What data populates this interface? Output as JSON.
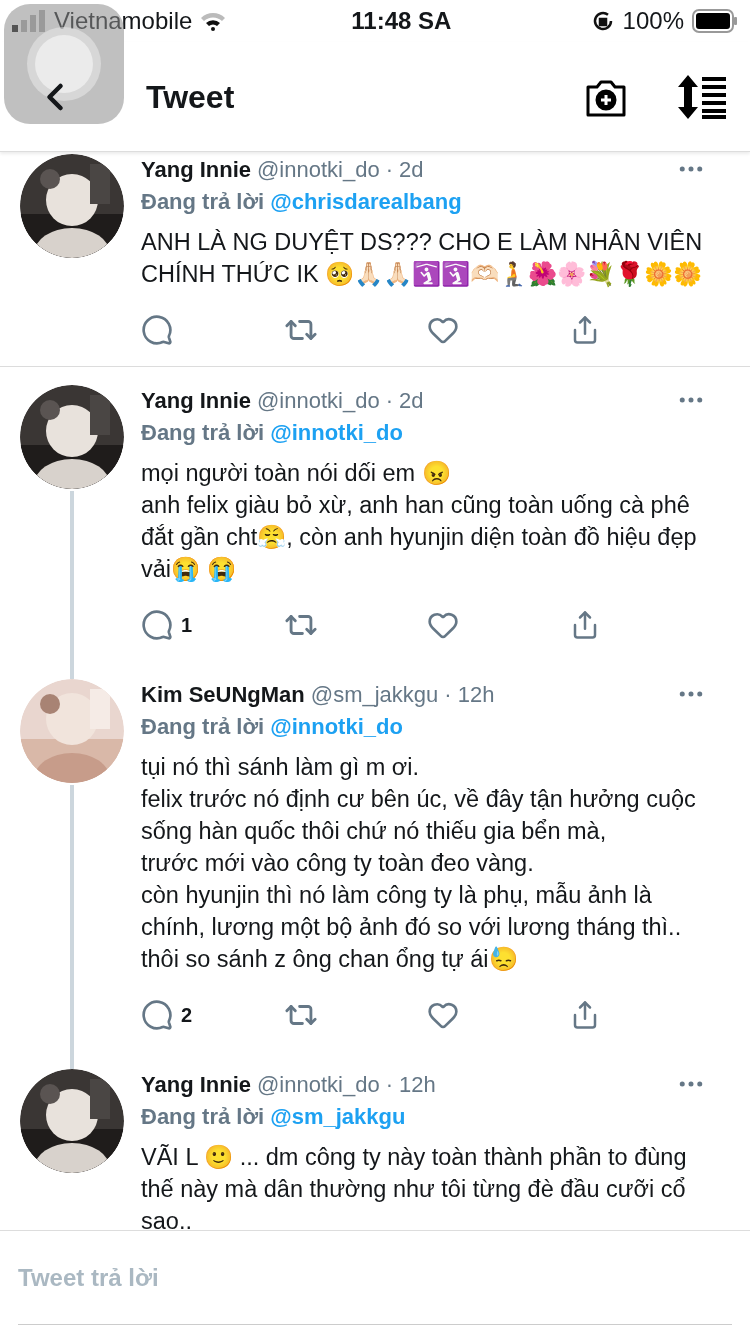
{
  "status_bar": {
    "carrier": "Vietnamobile",
    "time": "11:48 SA",
    "battery": "100%"
  },
  "header": {
    "title": "Tweet"
  },
  "tweets": [
    {
      "name": "Yang Innie",
      "handle": "@innotki_do",
      "time": "· 2d",
      "reply_label": "Đang trả lời",
      "reply_to": "@chrisdarealbang",
      "paragraphs": [
        "ANH LÀ NG DUYỆT DS??? CHO E LÀM NHÂN VIÊN CHÍNH THỨC IK 🥺🙏🏻🙏🏻🛐🛐🫶🏻🧎🌺🌸💐🌹🌼🌼"
      ],
      "connected": false
    },
    {
      "name": "Yang Innie",
      "handle": "@innotki_do",
      "time": "· 2d",
      "reply_label": "Đang trả lời",
      "reply_to": "@innotki_do",
      "paragraphs": [
        "mọi người toàn nói dối em 😠",
        "anh felix giàu bỏ xừ, anh han cũng toàn uống cà phê đắt gần cht😤, còn anh hyunjin diện toàn đồ hiệu đẹp vải😭 😭"
      ],
      "reply_count": "1",
      "connected": true
    },
    {
      "name": "Kim SeUNgMan",
      "handle": "@sm_jakkgu",
      "time": "· 12h",
      "reply_label": "Đang trả lời",
      "reply_to": "@innotki_do",
      "paragraphs": [
        "tụi nó thì sánh làm gì m ơi.",
        "felix trước nó định cư bên úc, về đây tận hưởng cuộc sống hàn quốc thôi chứ nó thiếu gia bển mà,",
        "trước mới vào công ty toàn đeo vàng.",
        "còn hyunjin thì nó làm công ty là phụ, mẫu ảnh là chính, lương một bộ ảnh đó so với lương tháng thì.. thôi so sánh z ông chan ổng tự ái😓"
      ],
      "reply_count": "2",
      "connected": true
    },
    {
      "name": "Yang Innie",
      "handle": "@innotki_do",
      "time": "· 12h",
      "reply_label": "Đang trả lời",
      "reply_to": "@sm_jakkgu",
      "paragraphs": [
        "VÃI L 🙂 ... dm công ty này toàn thành phần to đùng thế này mà dân thường như tôi từng đè đầu cưỡi cổ sao.."
      ],
      "connected": false
    }
  ],
  "composer": {
    "placeholder": "Tweet trả lời"
  }
}
